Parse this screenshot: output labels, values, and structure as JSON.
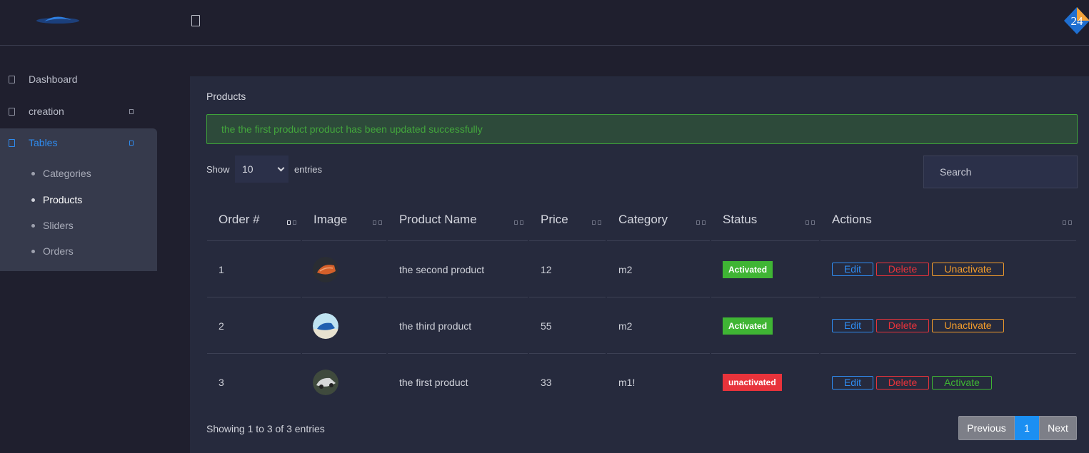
{
  "brand": {
    "badge_text": "24"
  },
  "sidebar": {
    "items": [
      {
        "label": "Dashboard"
      },
      {
        "label": "creation"
      },
      {
        "label": "Tables"
      }
    ],
    "sub_items": [
      {
        "label": "Categories"
      },
      {
        "label": "Products"
      },
      {
        "label": "Sliders"
      },
      {
        "label": "Orders"
      }
    ]
  },
  "panel": {
    "title": "Products",
    "alert": "the the first product product has been updated successfully",
    "show_label": "Show",
    "entries_value": "10",
    "entries_label": "entries",
    "search_placeholder": "Search"
  },
  "table": {
    "headers": [
      "Order #",
      "Image",
      "Product Name",
      "Price",
      "Category",
      "Status",
      "Actions"
    ],
    "rows": [
      {
        "order": "1",
        "image": "car-orange-thumb",
        "name": "the second product",
        "price": "12",
        "category": "m2",
        "status": "Activated",
        "actions": [
          "Edit",
          "Delete",
          "Unactivate"
        ]
      },
      {
        "order": "2",
        "image": "car-blue-thumb",
        "name": "the third product",
        "price": "55",
        "category": "m2",
        "status": "Activated",
        "actions": [
          "Edit",
          "Delete",
          "Unactivate"
        ]
      },
      {
        "order": "3",
        "image": "car-silver-thumb",
        "name": "the first product",
        "price": "33",
        "category": "m1!",
        "status": "unactivated",
        "actions": [
          "Edit",
          "Delete",
          "Activate"
        ]
      }
    ]
  },
  "footer": {
    "info": "Showing 1 to 3 of 3 entries",
    "previous": "Previous",
    "page": "1",
    "next": "Next"
  },
  "colors": {
    "background": "#1f1f2e",
    "panel": "#262a3d",
    "accent_blue": "#2f8cf0",
    "success": "#3fb534",
    "danger": "#e8333b",
    "warning": "#f29c2b"
  }
}
